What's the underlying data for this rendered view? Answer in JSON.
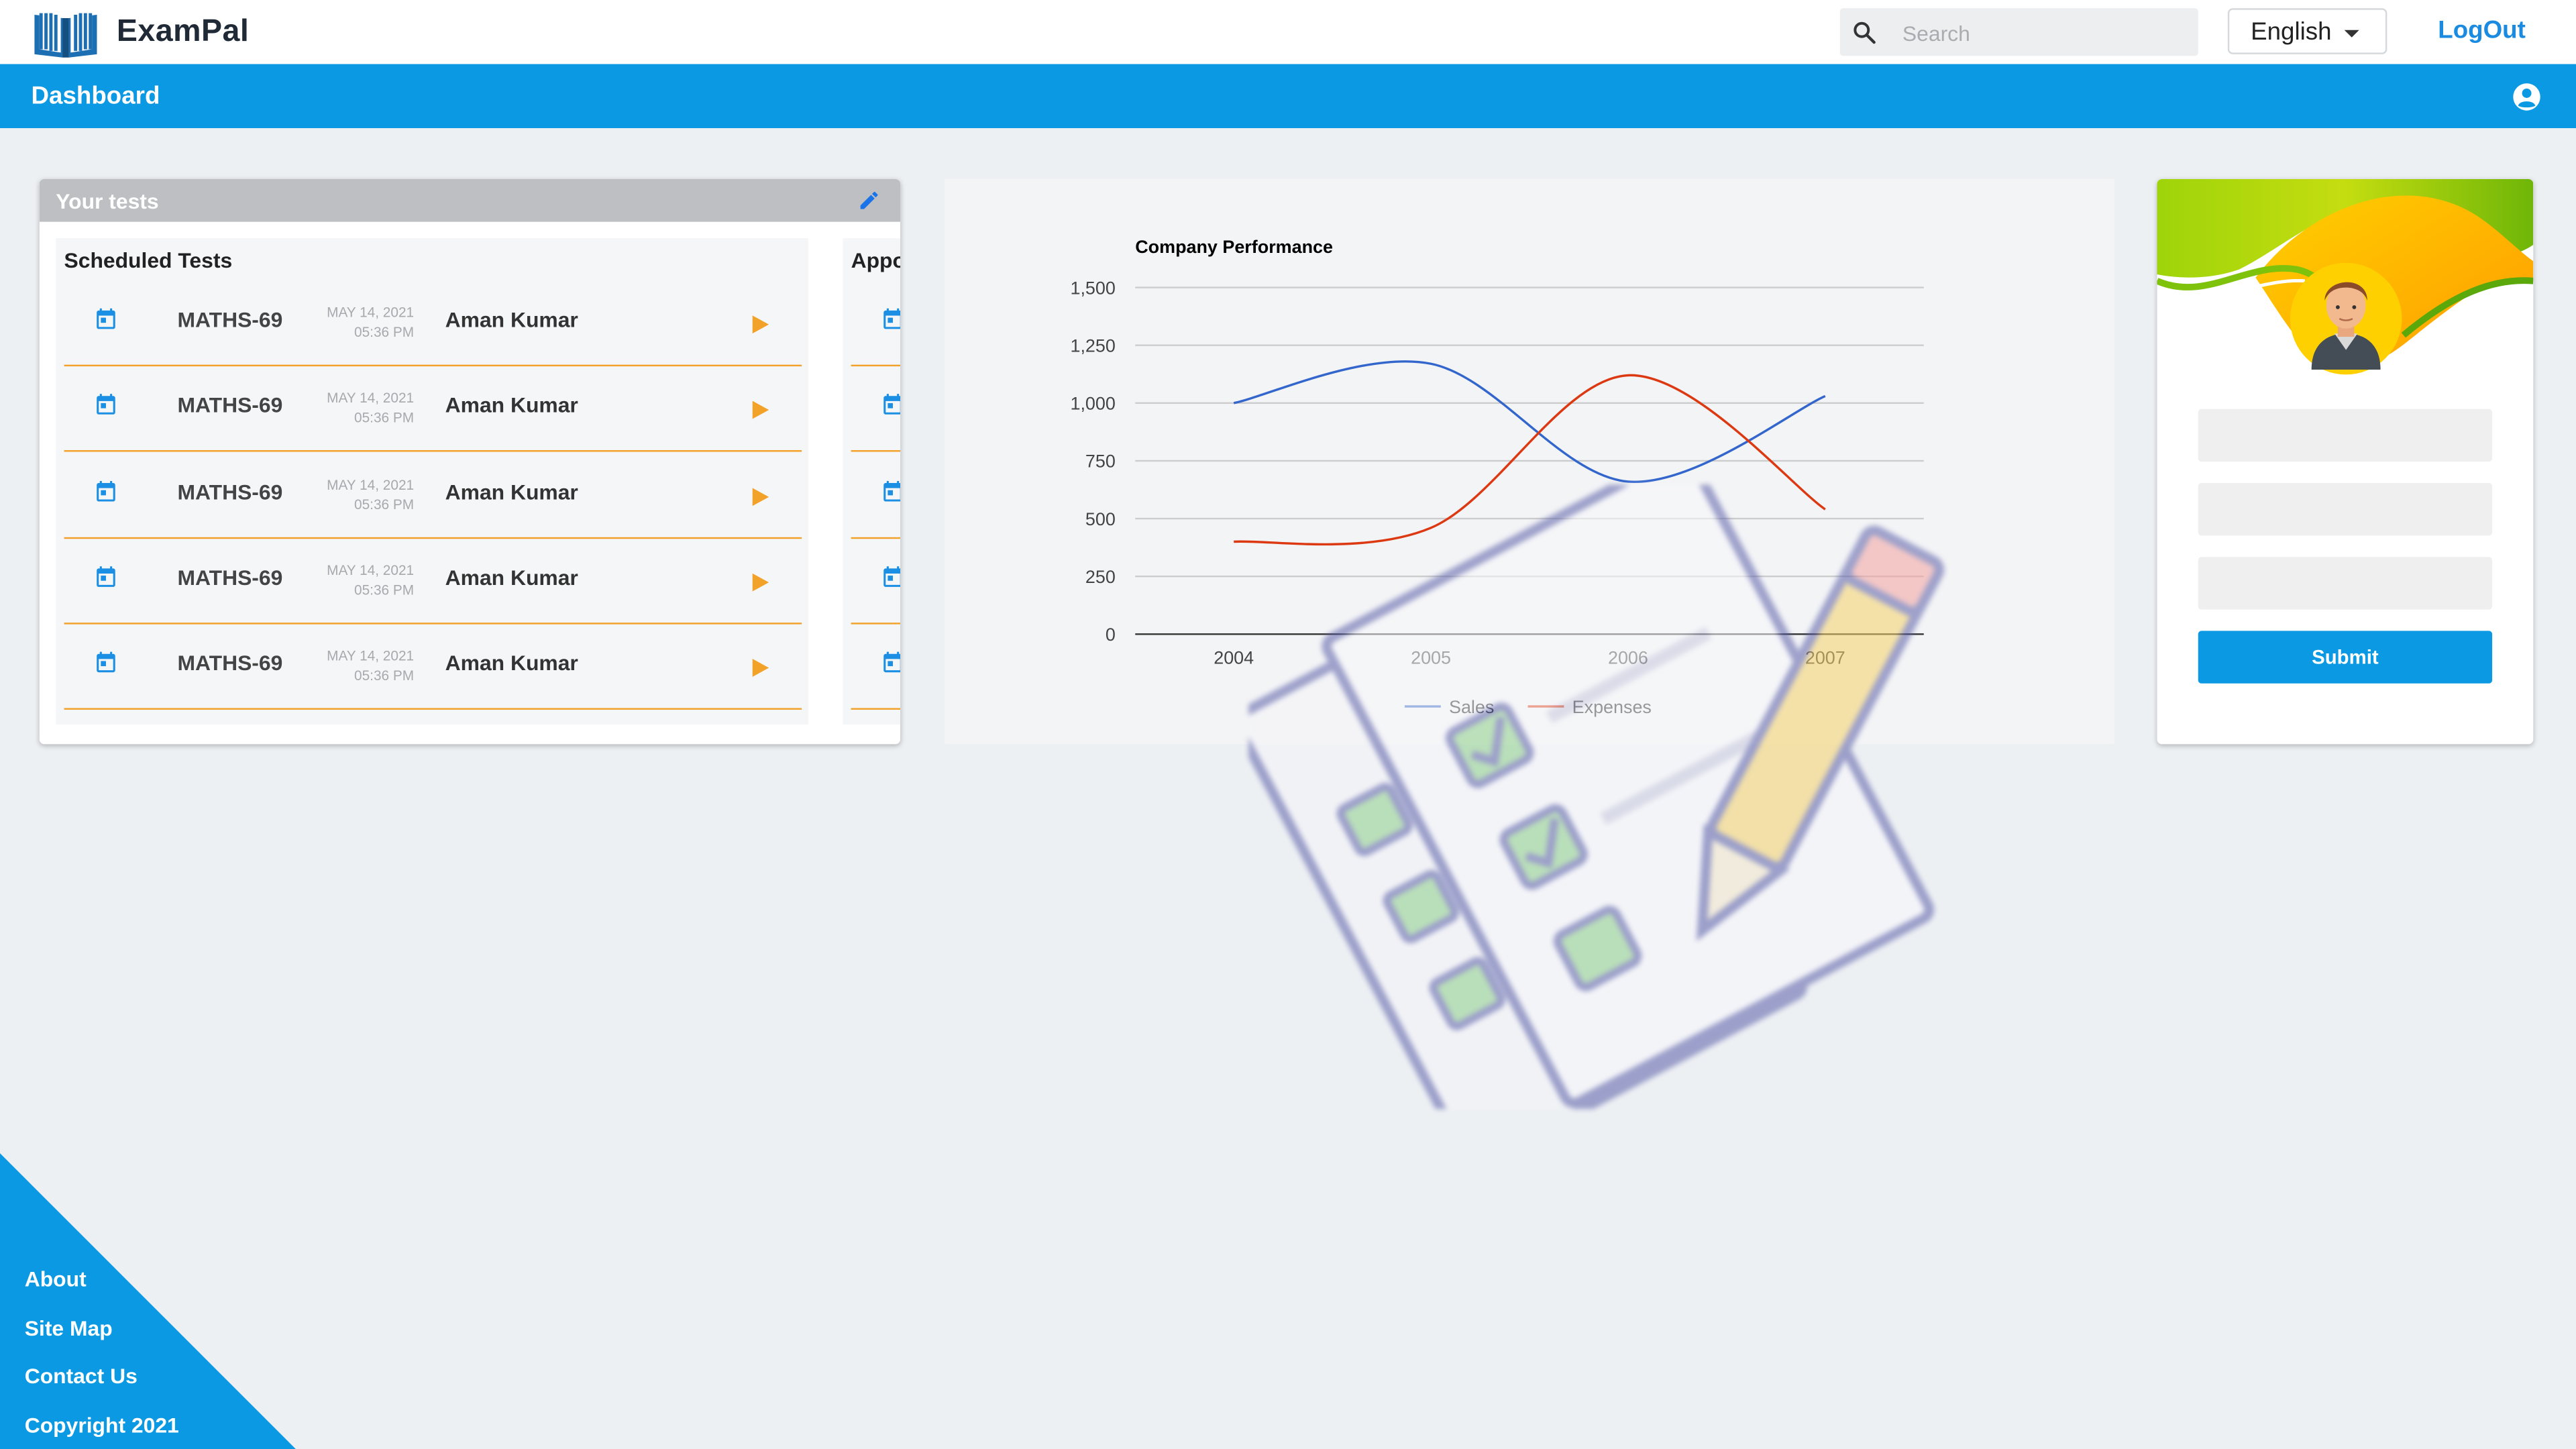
{
  "app": {
    "name": "ExamPal"
  },
  "search": {
    "placeholder": "Search"
  },
  "language": {
    "selected": "English"
  },
  "header": {
    "logout_label": "LogOut"
  },
  "nav": {
    "title": "Dashboard"
  },
  "tests_card": {
    "title": "Your tests",
    "scheduled": {
      "title": "Scheduled Tests",
      "rows": [
        {
          "code": "MATHS-69",
          "date": "MAY 14, 2021",
          "time": "05:36 PM",
          "name": "Aman Kumar"
        },
        {
          "code": "MATHS-69",
          "date": "MAY 14, 2021",
          "time": "05:36 PM",
          "name": "Aman Kumar"
        },
        {
          "code": "MATHS-69",
          "date": "MAY 14, 2021",
          "time": "05:36 PM",
          "name": "Aman Kumar"
        },
        {
          "code": "MATHS-69",
          "date": "MAY 14, 2021",
          "time": "05:36 PM",
          "name": "Aman Kumar"
        },
        {
          "code": "MATHS-69",
          "date": "MAY 14, 2021",
          "time": "05:36 PM",
          "name": "Aman Kumar"
        }
      ]
    },
    "second_panel": {
      "title": "Appo"
    }
  },
  "chart_data": {
    "type": "line",
    "title": "Company Performance",
    "x": [
      "2004",
      "2005",
      "2006",
      "2007"
    ],
    "series": [
      {
        "name": "Sales",
        "values": [
          1000,
          1170,
          660,
          1030
        ],
        "color": "#3366cc"
      },
      {
        "name": "Expenses",
        "values": [
          400,
          460,
          1120,
          540
        ],
        "color": "#dc3912"
      }
    ],
    "ylim": [
      0,
      1500
    ],
    "yticks": [
      0,
      250,
      500,
      750,
      1000,
      1250,
      1500
    ],
    "ytick_labels": [
      "0",
      "250",
      "500",
      "750",
      "1,000",
      "1,250",
      "1,500"
    ],
    "grid": true,
    "legend": "bottom"
  },
  "profile_card": {
    "submit_label": "Submit"
  },
  "footer": {
    "links": [
      "About",
      "Site Map",
      "Contact Us",
      "Copyright 2021"
    ],
    "color": "#0c99e4"
  },
  "colors": {
    "accent": "#0c99e4",
    "row_divider": "#f2a229",
    "play": "#f2a229"
  }
}
